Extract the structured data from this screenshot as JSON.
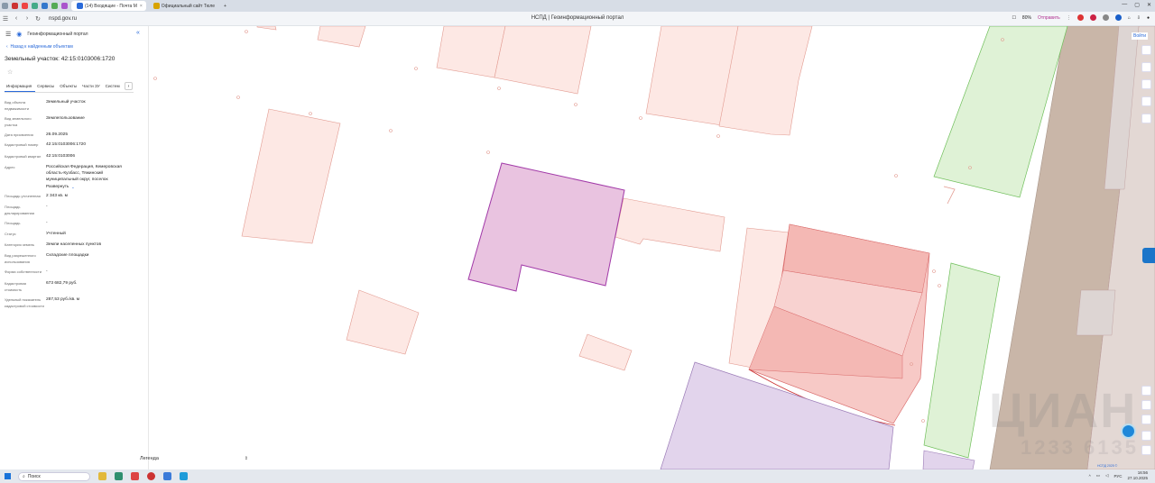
{
  "browser": {
    "tabs": [
      {
        "label": "(14) Входящие - Почта М"
      },
      {
        "label": "Официальный сайт Тюле"
      }
    ],
    "url": "nspd.gov.ru",
    "page_title": "НСПД | Геоинформационный портал",
    "zoom": "80%",
    "share_label": "Отправить"
  },
  "panel": {
    "portal_name": "Геоинформационный портал",
    "back_link": "Назад к найденным объектам",
    "title": "Земельный участок: 42:15:0103006:1720",
    "tabs": [
      "Информация",
      "Сервисы",
      "Объекты",
      "Части ЗУ",
      "Систем"
    ],
    "rows": [
      {
        "label": "Вид объекта недвижимости",
        "value": "Земельный участок"
      },
      {
        "label": "Вид земельного участка",
        "value": "Землепользование"
      },
      {
        "label": "Дата присвоения",
        "value": "26.09.2025"
      },
      {
        "label": "Кадастровый номер",
        "value": "42:15:0103006:1720"
      },
      {
        "label": "Кадастровый квартал",
        "value": "42:15:0103006"
      },
      {
        "label": "Адрес",
        "value": "Российская Федерация, Кемеровская область-Кузбасс, Тяжинский муниципальный округ, поселок"
      },
      {
        "label": "Площадь уточненная",
        "value": "2 343 кв. м"
      },
      {
        "label": "Площадь декларированная",
        "value": "-"
      },
      {
        "label": "Площадь",
        "value": "-"
      },
      {
        "label": "Статус",
        "value": "Учтенный"
      },
      {
        "label": "Категория земель",
        "value": "Земли населенных пунктов"
      },
      {
        "label": "Вид разрешенного использования",
        "value": "Складские площадки"
      },
      {
        "label": "Форма собственности",
        "value": "-"
      },
      {
        "label": "Кадастровая стоимость",
        "value": "673 682,79 руб."
      },
      {
        "label": "Удельный показатель кадастровой стоимости",
        "value": "287,53 руб./кв. м"
      }
    ],
    "expand_link": "Развернуть",
    "legend": "Легенда"
  },
  "map": {
    "login": "Войти",
    "watermark": "ЦИАН",
    "watermark_digits": "1233  6135",
    "scale": "НСПД 2025 ©"
  },
  "taskbar": {
    "search_placeholder": "Поиск",
    "lang": "РУС",
    "time": "16:56",
    "date": "27.10.2025"
  },
  "colors": {
    "selected_parcel": "#e9c3e0",
    "parcel_fill": "#fde8e4",
    "parcel_stroke": "#e29a90",
    "green_zone": "#dff2d6",
    "road": "#c9b6a8",
    "accent": "#2a6ad9"
  }
}
